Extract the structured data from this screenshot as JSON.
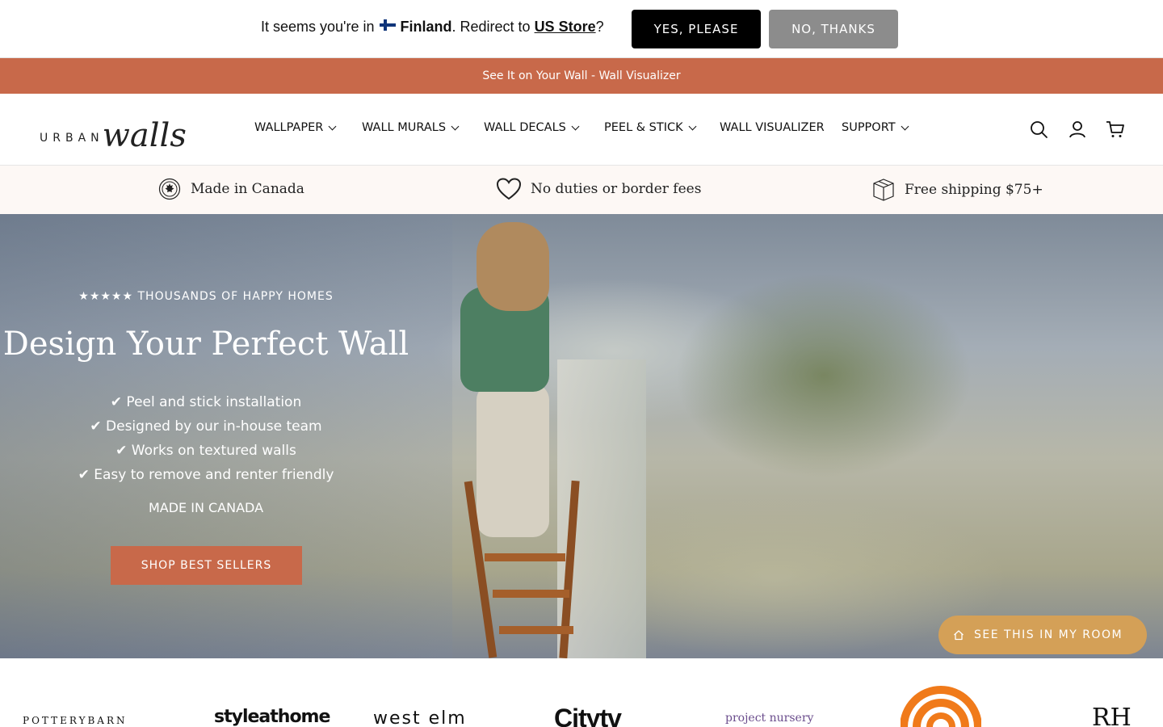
{
  "geo_banner": {
    "prefix": "It seems you're in",
    "country": "Finland",
    "middle": ". Redirect to",
    "store_link": "US Store",
    "suffix": "?",
    "yes_label": "YES, PLEASE",
    "no_label": "NO, THANKS"
  },
  "promo_bar": {
    "text": "See It on Your Wall - Wall Visualizer"
  },
  "header": {
    "logo": {
      "part1": "URBAN",
      "part2": "walls"
    },
    "nav": [
      {
        "label": "WALLPAPER",
        "has_dropdown": true
      },
      {
        "label": "WALL MURALS",
        "has_dropdown": true
      },
      {
        "label": "WALL DECALS",
        "has_dropdown": true
      },
      {
        "label": "PEEL & STICK",
        "has_dropdown": true
      },
      {
        "label": "WALL VISUALIZER",
        "has_dropdown": false
      },
      {
        "label": "SUPPORT",
        "has_dropdown": true
      }
    ],
    "icons": [
      "search-icon",
      "account-icon",
      "cart-icon"
    ]
  },
  "trust_bar": [
    {
      "icon": "canada-badge-icon",
      "text": "Made in Canada"
    },
    {
      "icon": "heart-icon",
      "text": "No duties or border fees"
    },
    {
      "icon": "package-icon",
      "text": "Free shipping $75+"
    }
  ],
  "hero": {
    "rating_line": "★★★★★ THOUSANDS OF HAPPY HOMES",
    "title": "Design Your Perfect Wall",
    "features": [
      "✔ Peel and stick installation",
      "✔ Designed by our in-house team",
      "✔ Works on textured walls",
      "✔ Easy to remove and renter friendly"
    ],
    "origin": "MADE IN CANADA",
    "cta": "SHOP BEST SELLERS"
  },
  "floating_button": {
    "label": "SEE THIS IN MY ROOM",
    "icon": "home-icon"
  },
  "press_logos": [
    "POTTERYBARN",
    "styleathome",
    "west elm",
    "Citytv",
    "project nursery",
    "TODAY",
    "RH"
  ],
  "colors": {
    "accent": "#c8694a",
    "floating_button": "#d4a057",
    "trust_bg": "#fdf8f5",
    "yes_button": "#000000",
    "no_button": "#8c8c8c"
  }
}
